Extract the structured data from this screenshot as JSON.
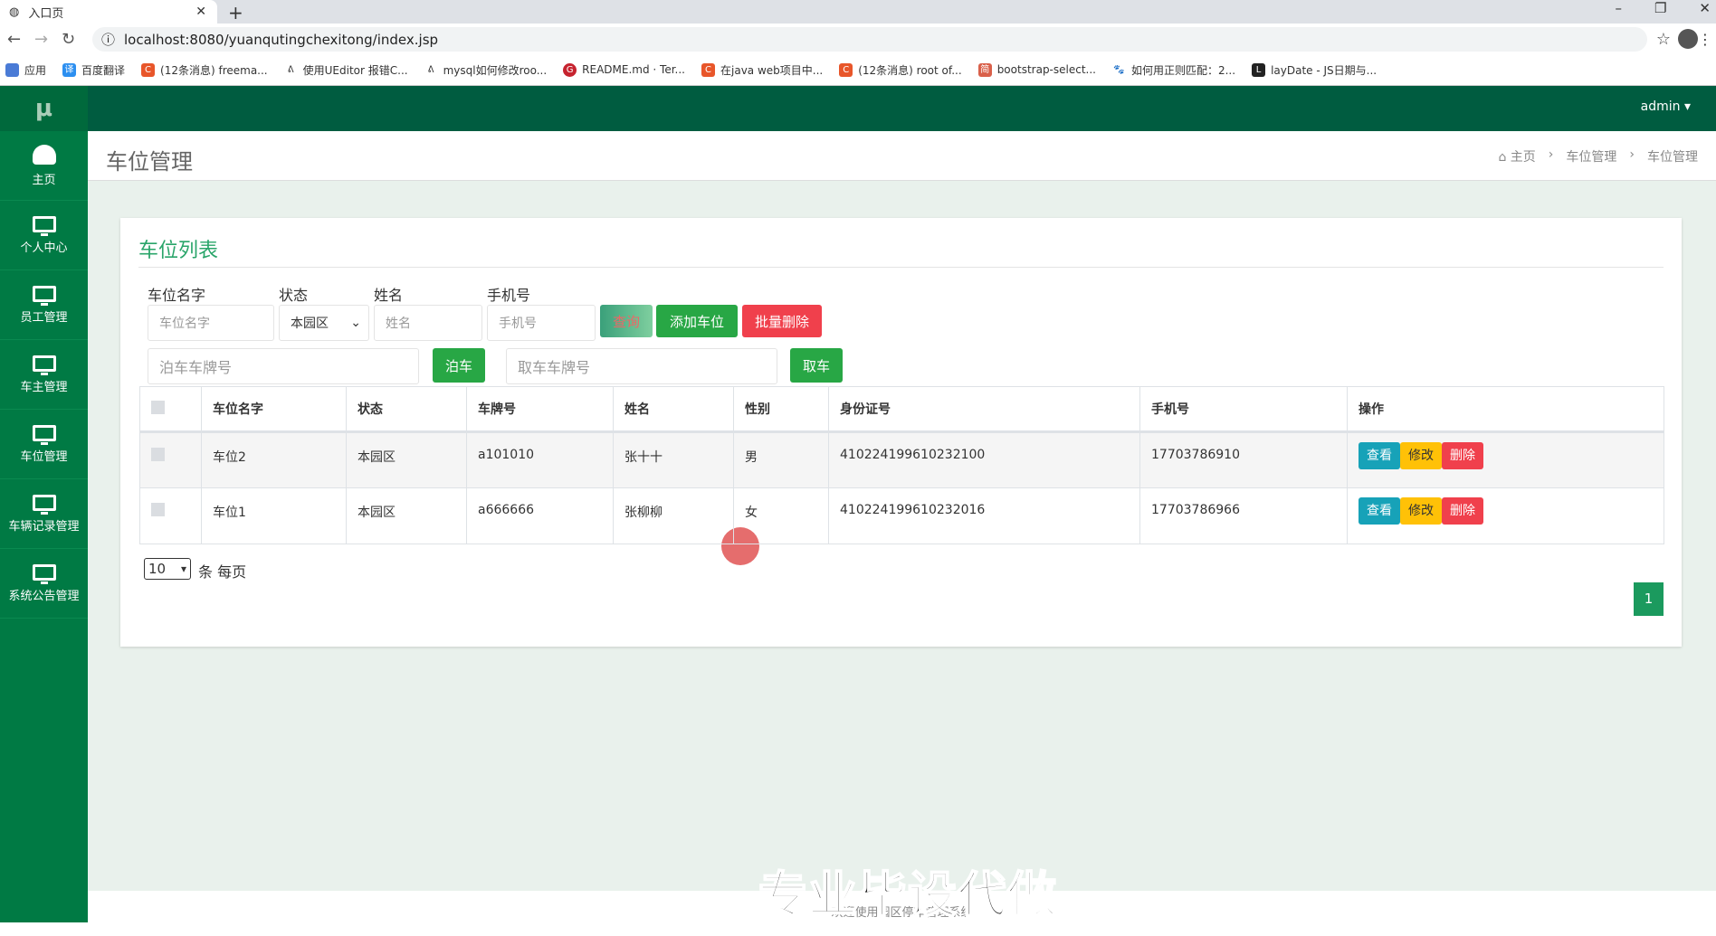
{
  "browser": {
    "tab_title": "入口页",
    "url": "localhost:8080/yuanqutingchexitong/index.jsp",
    "bookmarks": [
      "应用",
      "百度翻译",
      "(12条消息) freema...",
      "使用UEditor 报错C...",
      "mysql如何修改roo...",
      "README.md · Ter...",
      "在java web项目中...",
      "(12条消息) root of...",
      "bootstrap-select...",
      "如何用正则匹配：2...",
      "layDate - JS日期与..."
    ]
  },
  "app": {
    "logo": "μ",
    "user": "admin ▾"
  },
  "sidebar": {
    "items": [
      {
        "label": "主页",
        "icon": "dashboard-icon"
      },
      {
        "label": "个人中心",
        "icon": "monitor-icon"
      },
      {
        "label": "员工管理",
        "icon": "monitor-icon"
      },
      {
        "label": "车主管理",
        "icon": "monitor-icon"
      },
      {
        "label": "车位管理",
        "icon": "monitor-icon"
      },
      {
        "label": "车辆记录管理",
        "icon": "monitor-icon"
      },
      {
        "label": "系统公告管理",
        "icon": "monitor-icon"
      }
    ]
  },
  "page": {
    "title": "车位管理",
    "breadcrumb": [
      "主页",
      "车位管理",
      "车位管理"
    ]
  },
  "card": {
    "title": "车位列表",
    "filters": {
      "name_label": "车位名字",
      "name_placeholder": "车位名字",
      "status_label": "状态",
      "status_value": "本园区",
      "person_label": "姓名",
      "person_placeholder": "姓名",
      "phone_label": "手机号",
      "phone_placeholder": "手机号"
    },
    "buttons": {
      "search": "查询",
      "add": "添加车位",
      "batch_delete": "批量删除",
      "park": "泊车",
      "pickup": "取车"
    },
    "park_placeholder": "泊车车牌号",
    "pickup_placeholder": "取车车牌号",
    "table": {
      "headers": [
        "车位名字",
        "状态",
        "车牌号",
        "姓名",
        "性别",
        "身份证号",
        "手机号",
        "操作"
      ],
      "rows": [
        [
          "车位2",
          "本园区",
          "a101010",
          "张十十",
          "男",
          "410224199610232100",
          "17703786910"
        ],
        [
          "车位1",
          "本园区",
          "a666666",
          "张柳柳",
          "女",
          "410224199610232016",
          "17703786966"
        ]
      ],
      "actions": [
        "查看",
        "修改",
        "删除"
      ]
    },
    "page_size": "10",
    "page_size_suffix": "条 每页",
    "current_page": "1"
  },
  "footer": "欢迎使用园区停车管理系统",
  "watermark": "专业毕设代做"
}
